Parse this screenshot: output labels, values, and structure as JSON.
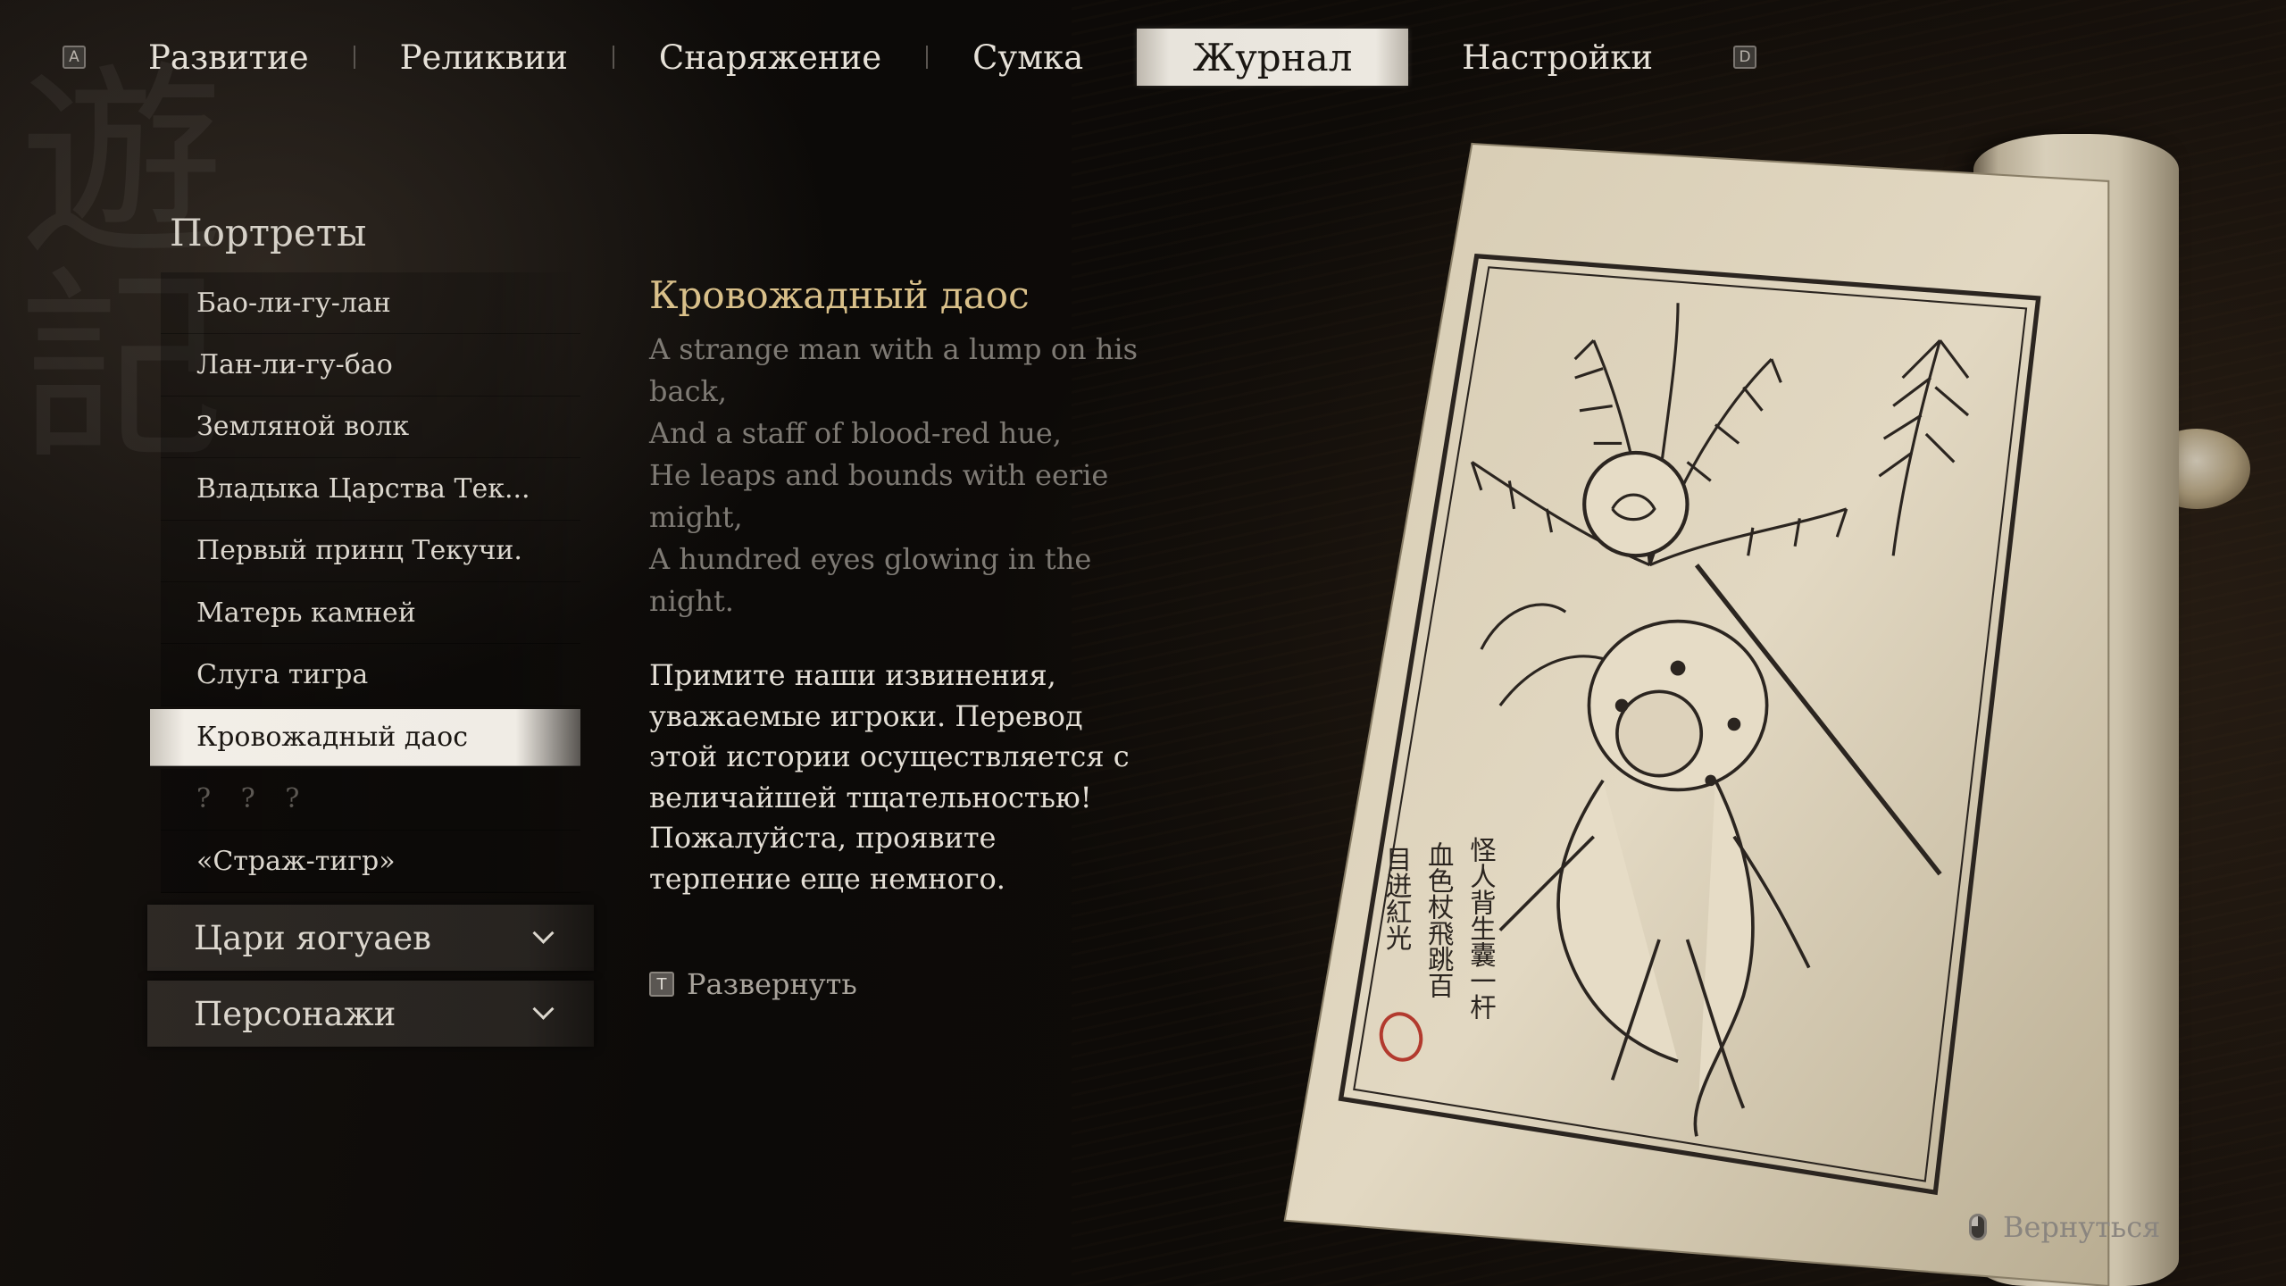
{
  "nav": {
    "left_key": "A",
    "right_key": "D",
    "tabs": [
      {
        "label": "Развитие"
      },
      {
        "label": "Реликвии"
      },
      {
        "label": "Снаряжение"
      },
      {
        "label": "Сумка"
      },
      {
        "label": "Журнал"
      },
      {
        "label": "Настройки"
      }
    ],
    "active_tab": "Журнал"
  },
  "sidebar": {
    "section_title": "Портреты",
    "items": [
      {
        "label": "Бао-ли-гу-лан"
      },
      {
        "label": "Лан-ли-гу-бао"
      },
      {
        "label": "Земляной волк"
      },
      {
        "label": "Владыка Царства Тек..."
      },
      {
        "label": "Первый принц Текучи."
      },
      {
        "label": "Матерь камней"
      },
      {
        "label": "Слуга тигра"
      },
      {
        "label": "Кровожадный даос"
      },
      {
        "label": "? ? ?"
      },
      {
        "label": "«Страж-тигр»"
      }
    ],
    "selected_item": "Кровожадный даос",
    "categories": [
      {
        "label": "Цари яогуаев"
      },
      {
        "label": "Персонажи"
      }
    ]
  },
  "entry": {
    "title": "Кровожадный даос",
    "poem_lines": [
      "A strange man with a lump on his back,",
      "And a staff of blood-red hue,",
      "He leaps and bounds with eerie might,",
      "A hundred eyes glowing in the night."
    ],
    "apology": "Примите наши извинения, уважаемые игроки. Перевод этой истории осуществляется с величайшей тщательностью! Пожалуйста, проявите терпение еще немного.",
    "expand_key": "T",
    "expand_label": "Развернуть"
  },
  "scroll": {
    "inscription_lines": [
      "怪人背生囊一杆",
      "血色杖飛跳百",
      "目迸紅光"
    ]
  },
  "footer": {
    "return_label": "Вернуться"
  },
  "colors": {
    "title_gold": "#d9c08a",
    "poem_gray": "#7e7a74",
    "seal_red": "#b23a2e"
  },
  "icons": {
    "chevron": "chevron-down-icon",
    "mouse": "mouse-icon"
  }
}
